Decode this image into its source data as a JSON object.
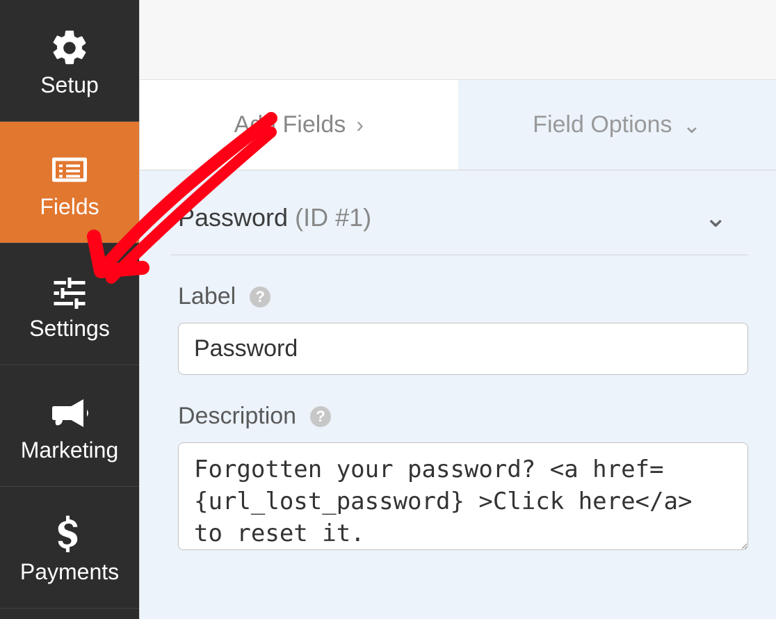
{
  "sidebar": {
    "items": [
      {
        "label": "Setup",
        "icon": "gear-icon",
        "active": false
      },
      {
        "label": "Fields",
        "icon": "list-icon",
        "active": true
      },
      {
        "label": "Settings",
        "icon": "sliders-icon",
        "active": false
      },
      {
        "label": "Marketing",
        "icon": "bullhorn-icon",
        "active": false
      },
      {
        "label": "Payments",
        "icon": "dollar-icon",
        "active": false
      }
    ]
  },
  "tabs": {
    "add_fields": "Add Fields",
    "field_options": "Field Options"
  },
  "field": {
    "title": "Password",
    "id_label": "(ID #1)"
  },
  "form": {
    "label_label": "Label",
    "label_value": "Password",
    "description_label": "Description",
    "description_value": "Forgotten your password? <a href={url_lost_password} >Click here</a> to reset it."
  },
  "annotation": {
    "type": "arrow",
    "color": "#ff0016",
    "target": "sidebar-item-settings"
  }
}
